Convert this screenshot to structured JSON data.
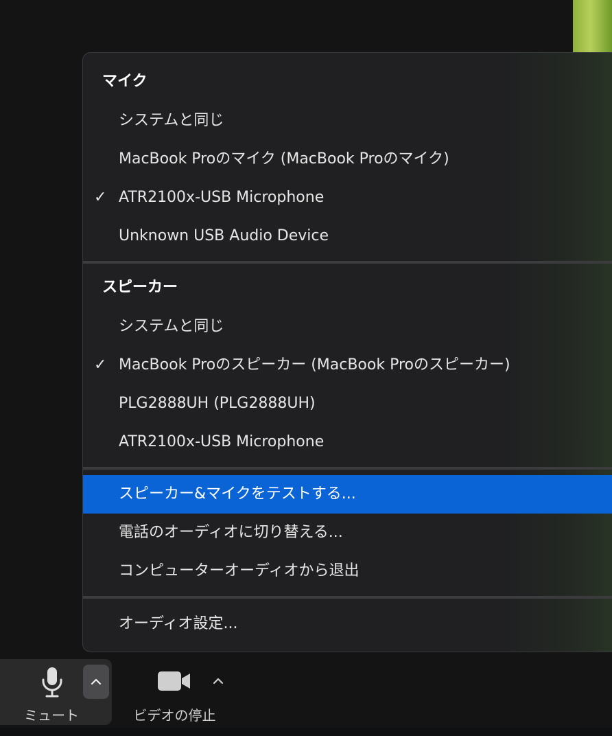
{
  "menu": {
    "mic_section": {
      "heading": "マイク",
      "items": [
        {
          "label": "システムと同じ",
          "checked": false
        },
        {
          "label": "MacBook Proのマイク (MacBook Proのマイク)",
          "checked": false
        },
        {
          "label": "ATR2100x-USB Microphone",
          "checked": true
        },
        {
          "label": "Unknown USB Audio Device",
          "checked": false
        }
      ]
    },
    "speaker_section": {
      "heading": "スピーカー",
      "items": [
        {
          "label": "システムと同じ",
          "checked": false
        },
        {
          "label": "MacBook Proのスピーカー (MacBook Proのスピーカー)",
          "checked": true
        },
        {
          "label": "PLG2888UH (PLG2888UH)",
          "checked": false
        },
        {
          "label": "ATR2100x-USB Microphone",
          "checked": false
        }
      ]
    },
    "actions": [
      {
        "label": "スピーカー&マイクをテストする...",
        "highlighted": true
      },
      {
        "label": "電話のオーディオに切り替える...",
        "highlighted": false
      },
      {
        "label": "コンピューターオーディオから退出",
        "highlighted": false
      }
    ],
    "settings": {
      "label": "オーディオ設定..."
    },
    "check_mark": "✓"
  },
  "toolbar": {
    "mute_label": "ミュート",
    "video_label": "ビデオの停止"
  },
  "icons": {
    "mic": "microphone-icon",
    "video": "video-camera-icon",
    "caret": "chevron-up-icon"
  },
  "colors": {
    "highlight": "#0a64d6",
    "menu_bg": "#202022",
    "background": "#141414"
  }
}
